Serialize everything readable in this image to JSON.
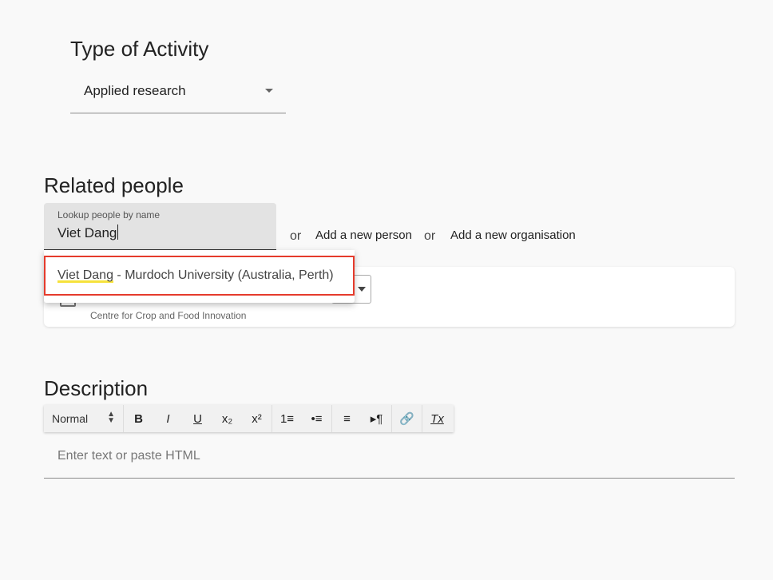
{
  "activity": {
    "heading": "Type of Activity",
    "selected": "Applied research"
  },
  "people": {
    "heading": "Related people",
    "lookup_label": "Lookup people by name",
    "lookup_value": "Viet Dang",
    "or_1": "or",
    "add_person": "Add a new person",
    "or_2": "or",
    "add_organisation": "Add a new organisation",
    "suggestion": {
      "match": "Viet Dang",
      "rest": " - Murdoch University (Australia, Perth)"
    },
    "card_org": "Centre for Crop and Food Innovation"
  },
  "description": {
    "heading": "Description",
    "format_value": "Normal",
    "placeholder": "Enter text or paste HTML",
    "toolbar": {
      "bold": "B",
      "italic": "I",
      "underline": "U",
      "subscript": "x₂",
      "superscript": "x²",
      "ordered_list": "1≡",
      "bullet_list": "•≡",
      "align": "≡",
      "direction": "▸¶",
      "link": "🔗",
      "clear": "Tx"
    }
  },
  "colors": {
    "highlight_border": "#e53b2c",
    "match_underline": "#f6e23c"
  }
}
